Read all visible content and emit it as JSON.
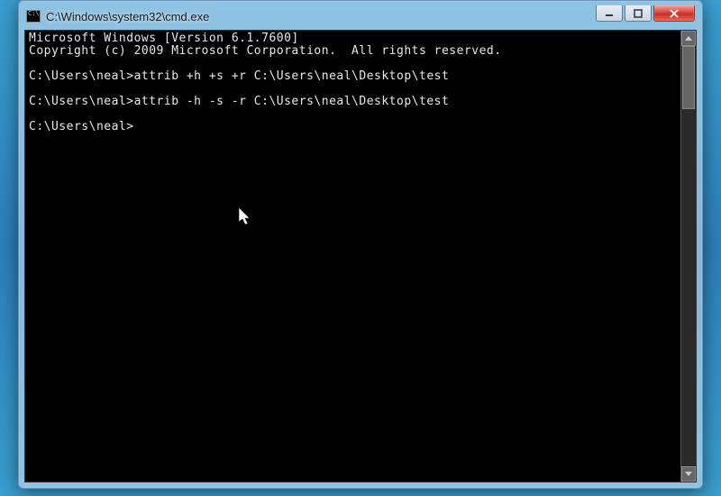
{
  "window": {
    "title": "C:\\Windows\\system32\\cmd.exe"
  },
  "console": {
    "line1": "Microsoft Windows [Version 6.1.7600]",
    "line2": "Copyright (c) 2009 Microsoft Corporation.  All rights reserved.",
    "line3": "C:\\Users\\neal>attrib +h +s +r C:\\Users\\neal\\Desktop\\test",
    "line4": "C:\\Users\\neal>attrib -h -s -r C:\\Users\\neal\\Desktop\\test",
    "line5": "C:\\Users\\neal>"
  }
}
